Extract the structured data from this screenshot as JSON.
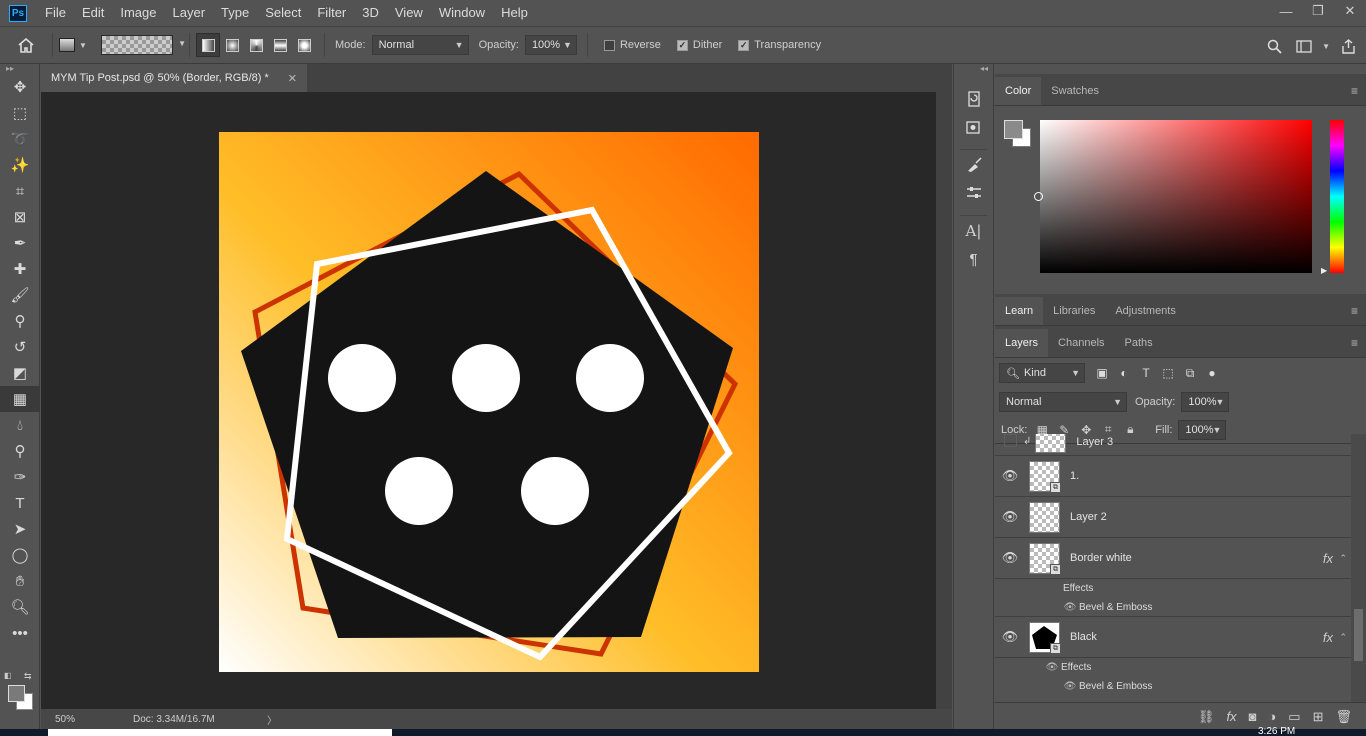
{
  "app": {
    "logo": "Ps"
  },
  "menu": [
    "File",
    "Edit",
    "Image",
    "Layer",
    "Type",
    "Select",
    "Filter",
    "3D",
    "View",
    "Window",
    "Help"
  ],
  "window_controls": {
    "minimize": "—",
    "restore": "❐",
    "close": "✕"
  },
  "options_bar": {
    "mode_label": "Mode:",
    "mode_value": "Normal",
    "opacity_label": "Opacity:",
    "opacity_value": "100%",
    "reverse_label": "Reverse",
    "reverse_checked": false,
    "dither_label": "Dither",
    "dither_checked": true,
    "transparency_label": "Transparency",
    "transparency_checked": true
  },
  "document": {
    "tab_title": "MYM Tip Post.psd @ 50% (Border, RGB/8) *",
    "zoom": "50%",
    "doc_size": "Doc: 3.34M/16.7M"
  },
  "tools": [
    "move-tool",
    "marquee-tool",
    "lasso-tool",
    "magic-wand-tool",
    "crop-tool",
    "frame-tool",
    "eyedropper-tool",
    "healing-brush-tool",
    "brush-tool",
    "clone-stamp-tool",
    "history-brush-tool",
    "eraser-tool",
    "gradient-tool",
    "blur-tool",
    "dodge-tool",
    "pen-tool",
    "type-tool",
    "path-selection-tool",
    "ellipse-tool",
    "hand-tool",
    "zoom-tool",
    "more-tools"
  ],
  "color_panel": {
    "tabs": [
      "Color",
      "Swatches"
    ],
    "active_tab": "Color",
    "foreground": "#8a8a8a",
    "background": "#ffffff"
  },
  "learn_panel": {
    "tabs": [
      "Learn",
      "Libraries",
      "Adjustments"
    ]
  },
  "layers_panel": {
    "tabs": [
      "Layers",
      "Channels",
      "Paths"
    ],
    "kind_label": "Kind",
    "blend_mode": "Normal",
    "opacity_label": "Opacity:",
    "opacity_value": "100%",
    "lock_label": "Lock:",
    "fill_label": "Fill:",
    "fill_value": "100%",
    "layers": [
      {
        "name": "Layer 3",
        "visible": false,
        "clipped": true
      },
      {
        "name": "1.",
        "visible": true
      },
      {
        "name": "Layer 2",
        "visible": true
      },
      {
        "name": "Border white",
        "visible": true,
        "fx": "fx",
        "effects_label": "Effects",
        "effects": [
          "Bevel & Emboss"
        ]
      },
      {
        "name": "Black",
        "visible": true,
        "fx": "fx",
        "effects_label": "Effects",
        "effects": [
          "Bevel & Emboss"
        ]
      }
    ]
  },
  "artwork": {
    "gradient_start": "#ffffff",
    "gradient_mid": "#ffbe28",
    "gradient_end": "#ff6a00",
    "shape_fill": "#141414",
    "border_white": "#ffffff",
    "border_orange": "#cc3300",
    "dots": 5
  },
  "taskbar": {
    "clock": "3:26 PM"
  }
}
